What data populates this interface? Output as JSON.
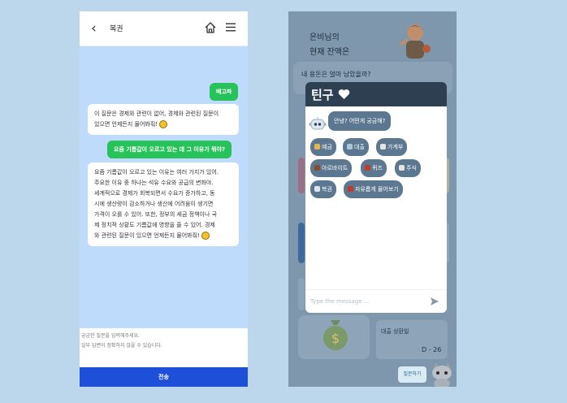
{
  "left_phone": {
    "header_title": "복권",
    "messages": [
      {
        "role": "user",
        "text": "배고파"
      },
      {
        "role": "bot",
        "lines": [
          "이 질문은 경제와 관련이 없어, 경제와 관련된 질문이",
          "있으면 언제든지 물어봐줘!"
        ]
      },
      {
        "role": "user",
        "text": "요즘 기름값이 오르고 있는 데 그 이유가 뭐야?"
      },
      {
        "role": "bot",
        "lines": [
          "요즘 기름값이 오르고 있는 이유는 여러 가지가 있어.",
          "주요한 이유 중 하나는 석유 수요와 공급의 변화야.",
          "세계적으로 경제가 회복되면서 수요가 증가하고, 동",
          "시에 생산량이 감소하거나 생산에 어려움이 생기면",
          "가격이 오를 수 있어. 또한, 정부의 세금 정책이나 국",
          "제 정치적 상황도 기름값에 영향을 줄 수 있어. 경제",
          "와 관련된 질문이 있으면 언제든지 물어봐줘!"
        ]
      }
    ],
    "input_hint_line1": "궁금한 질문을 입력해주세요.",
    "input_hint_line2": "일부 답변이 정확하지 않을 수 있습니다.",
    "send_label": "전송"
  },
  "right_phone": {
    "background_text_line1": "은비님의",
    "background_text_line2": "현재 잔액은",
    "background_question": "내 용돈은 얼마 남았을까?",
    "loan_label": "대출 상환일",
    "loan_dday": "D - 26",
    "ask_button_label": "질문하기",
    "chatbot": {
      "title": "틴구",
      "greeting": "안녕? 어떤게 궁금해?",
      "chips": [
        {
          "label": "예금",
          "icon": "moneybag-icon",
          "color": "#e8b54a"
        },
        {
          "label": "대출",
          "icon": "piggy-icon",
          "color": "#a8c7d8"
        },
        {
          "label": "가계부",
          "icon": "calendar-icon",
          "color": "#e9e4df"
        },
        {
          "label": "아르바이트",
          "icon": "person-icon",
          "color": "#8a4b2a"
        },
        {
          "label": "퀴즈",
          "icon": "quiz-icon",
          "color": "#c0392b"
        },
        {
          "label": "주식",
          "icon": "chart-icon",
          "color": "#e9e4df"
        },
        {
          "label": "복권",
          "icon": "ticket-icon",
          "color": "#dfe6ec"
        },
        {
          "label": "자유롭게 물어보기",
          "icon": "pin-icon",
          "color": "#c0392b"
        }
      ],
      "input_placeholder": "Type the message ..."
    }
  }
}
